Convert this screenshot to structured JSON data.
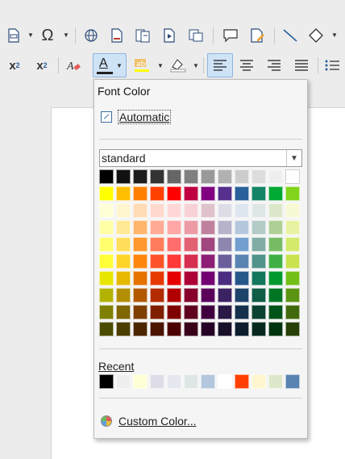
{
  "popup": {
    "title": "Font Color",
    "automatic_label": "Automatic",
    "palette_selected": "standard",
    "recent_label": "Recent",
    "custom_color_label": "Custom Color..."
  },
  "toolbar": {
    "superscript_label": "x",
    "subscript_label": "x",
    "font_color_letter": "A"
  },
  "colors": {
    "accent": "#2a4a78",
    "active_button": "#cfe3f7"
  },
  "grid_colors": [
    [
      "#000000",
      "#111111",
      "#1c1c1c",
      "#333333",
      "#666666",
      "#808080",
      "#999999",
      "#b2b2b2",
      "#cccccc",
      "#dddddd",
      "#eeeeee",
      "#ffffff"
    ],
    [
      "#ffff00",
      "#ffbf00",
      "#ff8000",
      "#ff4000",
      "#ff0000",
      "#bf0041",
      "#800080",
      "#55308d",
      "#2a6099",
      "#158466",
      "#00a933",
      "#81d41a"
    ],
    [
      "#ffffd7",
      "#fff5ce",
      "#ffdbb6",
      "#ffd8ce",
      "#ffd7d7",
      "#f7d1d5",
      "#e0c2cd",
      "#dedce6",
      "#dee6ef",
      "#dee7e5",
      "#dde8cb",
      "#f6f9d4"
    ],
    [
      "#ffffa6",
      "#ffe994",
      "#ffb66c",
      "#ffaa95",
      "#ffa6a6",
      "#ec9ba4",
      "#bf819e",
      "#b7b3ca",
      "#b4c7dc",
      "#b3cac7",
      "#afd095",
      "#e8f2a1"
    ],
    [
      "#ffff6d",
      "#ffde59",
      "#ff972f",
      "#ff7b59",
      "#ff6d6d",
      "#e16173",
      "#a1467e",
      "#8e86ae",
      "#729fcf",
      "#81aca6",
      "#77bc65",
      "#d4ea6b"
    ],
    [
      "#ffff38",
      "#ffd428",
      "#ff860d",
      "#ff5429",
      "#ff3838",
      "#d62e4e",
      "#8d1d75",
      "#6b5e9b",
      "#5983b0",
      "#50938a",
      "#3faf46",
      "#c9e24e"
    ],
    [
      "#e6e600",
      "#e6b800",
      "#e67300",
      "#e63900",
      "#e60000",
      "#ac0037",
      "#730073",
      "#4c2c80",
      "#26578a",
      "#13775c",
      "#00992e",
      "#73bf17"
    ],
    [
      "#b2b200",
      "#b28f00",
      "#b25900",
      "#b22c00",
      "#b20000",
      "#86002b",
      "#5a005a",
      "#3b2263",
      "#1e436b",
      "#0f5c47",
      "#007624",
      "#5a9412"
    ],
    [
      "#7f7f00",
      "#7f6600",
      "#7f3f00",
      "#7f1f00",
      "#7f0000",
      "#60001f",
      "#400040",
      "#2a1846",
      "#15304c",
      "#0b4232",
      "#005419",
      "#406a0d"
    ],
    [
      "#4c4c00",
      "#4c3d00",
      "#4c2600",
      "#4c1300",
      "#4c0000",
      "#39001a",
      "#260026",
      "#19102a",
      "#0c1d2e",
      "#06281e",
      "#00330f",
      "#264008"
    ]
  ],
  "recent_colors": [
    "#000000",
    "#eeeeee",
    "#ffffd7",
    "#dedce6",
    "#e6e8f0",
    "#dee7e5",
    "#b4c7dc",
    "#ffffff",
    "#ff4000",
    "#fff5ce",
    "#dde8cb",
    "#5983b0"
  ]
}
